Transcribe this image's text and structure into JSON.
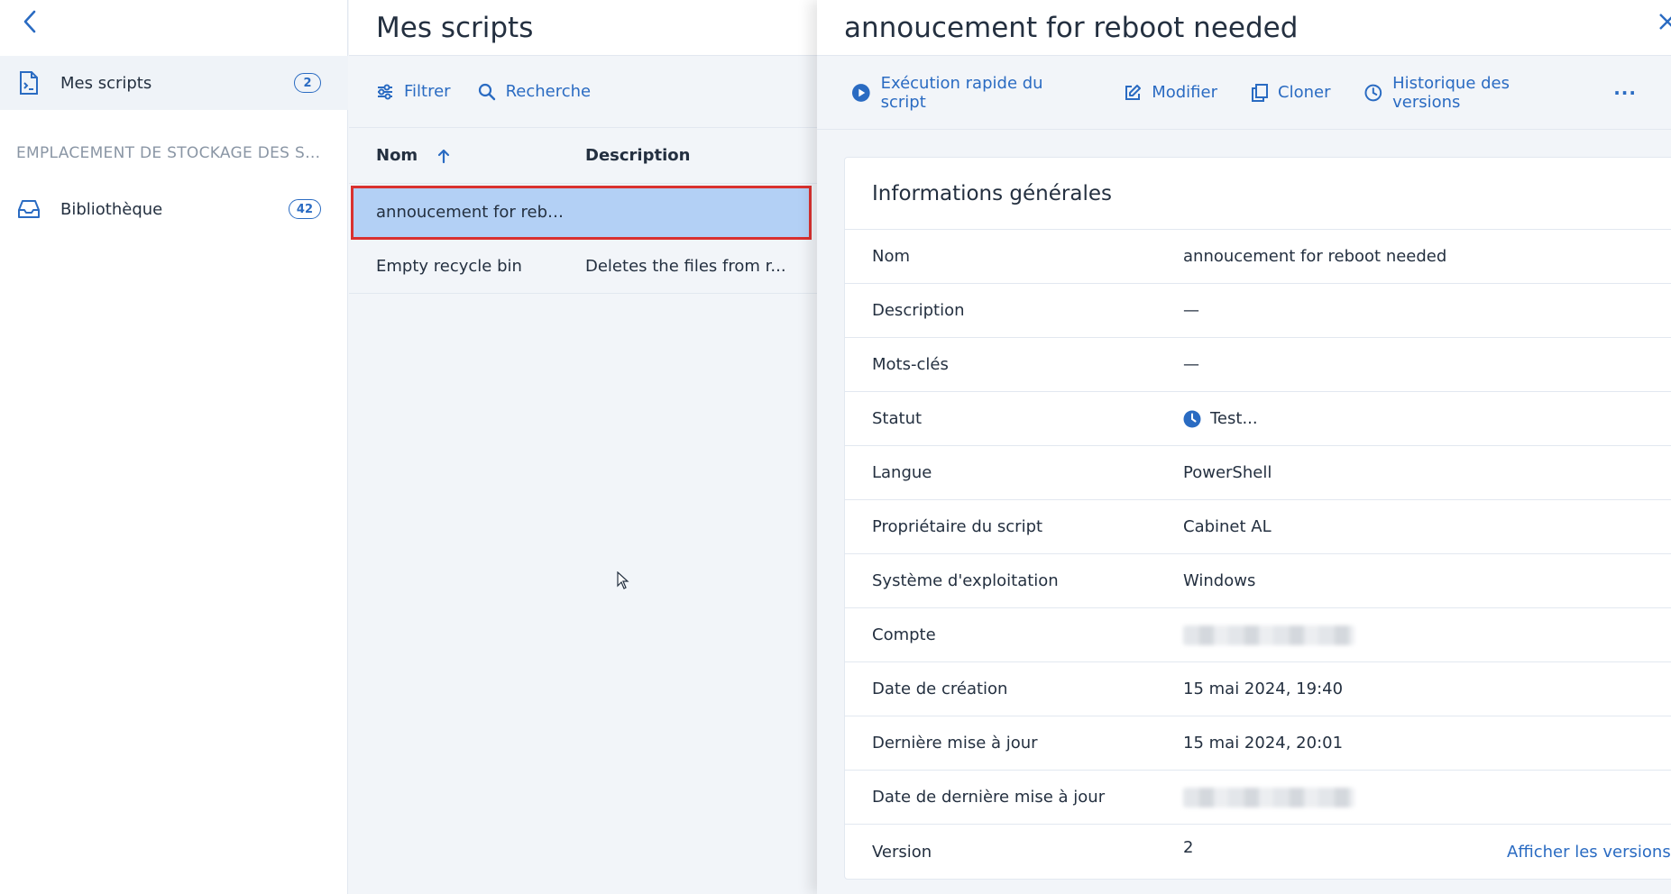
{
  "sidebar": {
    "items": [
      {
        "label": "Mes scripts",
        "count": "2",
        "icon": "script-file-icon"
      },
      {
        "label": "Bibliothèque",
        "count": "42",
        "icon": "inbox-tray-icon"
      }
    ],
    "section_title": "EMPLACEMENT DE STOCKAGE DES SC..."
  },
  "list": {
    "title": "Mes scripts",
    "filter_label": "Filtrer",
    "search_label": "Recherche",
    "columns": {
      "name": "Nom",
      "description": "Description"
    },
    "rows": [
      {
        "name": "annoucement for rebo...",
        "description": ""
      },
      {
        "name": "Empty recycle bin",
        "description": "Deletes the files from r..."
      }
    ]
  },
  "detail": {
    "title": "annoucement for reboot needed",
    "actions": {
      "run": "Exécution rapide du script",
      "edit": "Modifier",
      "clone": "Cloner",
      "history": "Historique des versions",
      "more": "···"
    },
    "card_title": "Informations générales",
    "fields": {
      "name": {
        "key": "Nom",
        "value": "annoucement for reboot needed"
      },
      "description": {
        "key": "Description",
        "value": "—"
      },
      "tags": {
        "key": "Mots-clés",
        "value": "—"
      },
      "status": {
        "key": "Statut",
        "value": "Test..."
      },
      "language": {
        "key": "Langue",
        "value": "PowerShell"
      },
      "owner": {
        "key": "Propriétaire du script",
        "value": "Cabinet AL"
      },
      "os": {
        "key": "Système d'exploitation",
        "value": "Windows"
      },
      "account": {
        "key": "Compte"
      },
      "created": {
        "key": "Date de création",
        "value": "15 mai 2024, 19:40"
      },
      "updated": {
        "key": "Dernière mise à jour",
        "value": "15 mai 2024, 20:01"
      },
      "last_update_date": {
        "key": "Date de dernière mise à jour"
      },
      "version": {
        "key": "Version",
        "value": "2",
        "link": "Afficher les versions"
      }
    }
  },
  "colors": {
    "accent": "#2a6bc2",
    "selection": "#b3d0f5",
    "highlight_border": "#d9312f"
  }
}
